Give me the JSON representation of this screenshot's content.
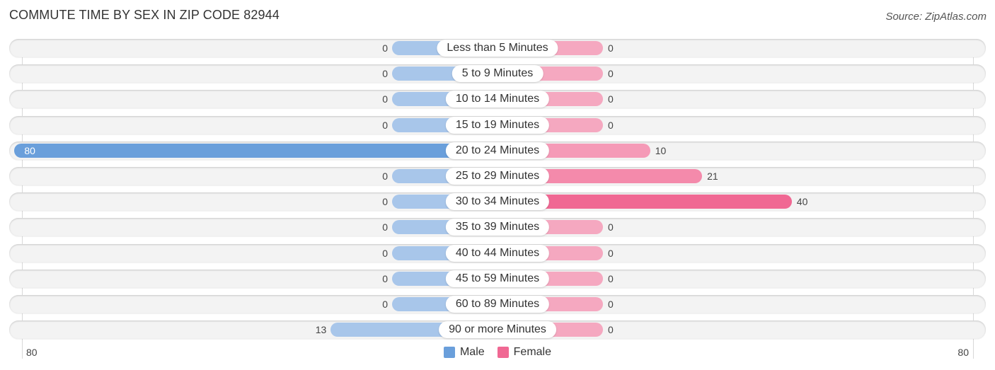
{
  "chart_data": {
    "type": "bar",
    "orientation": "horizontal-diverging",
    "title": "COMMUTE TIME BY SEX IN ZIP CODE 82944",
    "source": "Source: ZipAtlas.com",
    "categories": [
      "Less than 5 Minutes",
      "5 to 9 Minutes",
      "10 to 14 Minutes",
      "15 to 19 Minutes",
      "20 to 24 Minutes",
      "25 to 29 Minutes",
      "30 to 34 Minutes",
      "35 to 39 Minutes",
      "40 to 44 Minutes",
      "45 to 59 Minutes",
      "60 to 89 Minutes",
      "90 or more Minutes"
    ],
    "series": [
      {
        "name": "Male",
        "color": "#6a9fdb",
        "light_color": "#a8c6ea",
        "side": "left",
        "values": [
          0,
          0,
          0,
          0,
          80,
          0,
          0,
          0,
          0,
          0,
          0,
          13
        ]
      },
      {
        "name": "Female",
        "color": "#f06893",
        "light_color": "#f5a8c0",
        "side": "right",
        "values": [
          0,
          0,
          0,
          0,
          10,
          21,
          40,
          0,
          0,
          0,
          0,
          0
        ]
      }
    ],
    "axis": {
      "left_max_label": "80",
      "right_max_label": "80",
      "xlim": [
        -80,
        80
      ]
    },
    "legend": {
      "position": "bottom-center",
      "entries": [
        "Male",
        "Female"
      ]
    },
    "grid": false
  }
}
